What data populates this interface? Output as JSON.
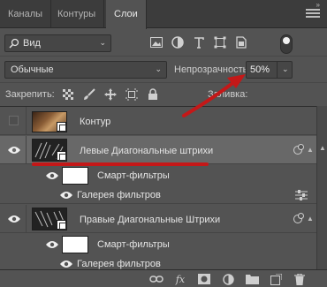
{
  "tabs": [
    {
      "label": "Каналы",
      "active": false
    },
    {
      "label": "Контуры",
      "active": false
    },
    {
      "label": "Слои",
      "active": true
    }
  ],
  "filter": {
    "kind_label": "Вид",
    "icons": [
      "image-filter-icon",
      "adjustment-filter-icon",
      "type-filter-icon",
      "shape-filter-icon",
      "smart-object-filter-icon"
    ],
    "toggle_on": true
  },
  "blend": {
    "mode": "Обычные",
    "opacity_label": "Непрозрачность:",
    "opacity_value": "50%"
  },
  "lock": {
    "label": "Закрепить:",
    "fill_label": "Заливка:",
    "icons": [
      "lock-transparent-icon",
      "lock-paint-icon",
      "lock-move-icon",
      "lock-artboard-icon",
      "lock-all-icon"
    ]
  },
  "layers": [
    {
      "name": "Контур",
      "visible": false,
      "selected": false,
      "thumb": "photo"
    },
    {
      "name": "Левые Диагональные штрихи",
      "visible": true,
      "selected": true,
      "thumb": "sketch"
    },
    {
      "name": "Смарт-фильтры",
      "visible": true,
      "selected": false,
      "thumb": "mask"
    },
    {
      "name": "Галерея фильтров",
      "visible": true,
      "selected": false,
      "thumb": "none"
    },
    {
      "name": "Правые Диагональные Штрихи",
      "visible": true,
      "selected": false,
      "thumb": "sketch"
    },
    {
      "name": "Смарт-фильтры",
      "visible": true,
      "selected": false,
      "thumb": "mask"
    },
    {
      "name": "Галерея фильтров",
      "visible": true,
      "selected": false,
      "thumb": "none"
    }
  ],
  "bottom_icons": [
    "link-layers-icon",
    "fx-icon",
    "add-mask-icon",
    "adjustment-layer-icon",
    "new-group-icon",
    "new-layer-icon",
    "delete-layer-icon"
  ],
  "bottom": {
    "fx_label": "fx"
  },
  "colors": {
    "panel_bg": "#535353",
    "tab_bar": "#3c3c3c",
    "selected_row": "#686868",
    "annotation_red": "#c41818"
  }
}
